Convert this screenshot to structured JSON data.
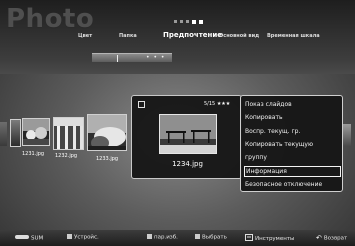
{
  "app": {
    "title": "Photo"
  },
  "tabs": [
    {
      "label": "Цвет"
    },
    {
      "label": "Папка"
    },
    {
      "label": "Предпочтение"
    },
    {
      "label": "Основной вид"
    },
    {
      "label": "Временная шкала"
    }
  ],
  "sort_bar": {
    "indicator": "• • •"
  },
  "thumbnails": [
    {
      "label": "1231.jpg"
    },
    {
      "label": "1232.jpg"
    },
    {
      "label": "1233.jpg"
    }
  ],
  "selected": {
    "counter": "5/15 ★★★",
    "filename": "1234.jpg"
  },
  "context_menu": {
    "items": [
      {
        "label": "Показ слайдов"
      },
      {
        "label": "Копировать"
      },
      {
        "label": "Воспр. текущ. гр."
      },
      {
        "label": "Копировать текущую"
      },
      {
        "label": "группу"
      },
      {
        "label": "Информация"
      },
      {
        "label": "Безопасное отключение"
      }
    ],
    "active_index": 5
  },
  "bottom_bar": {
    "sum_label": "SUM",
    "device_label": "Устройс.",
    "select_photo": "пар.изб.",
    "select": "Выбрать",
    "tools": "Инструменты",
    "back": "Возврат"
  },
  "colors": {
    "accent": "#ffffff",
    "background": "#5c5c5c"
  }
}
